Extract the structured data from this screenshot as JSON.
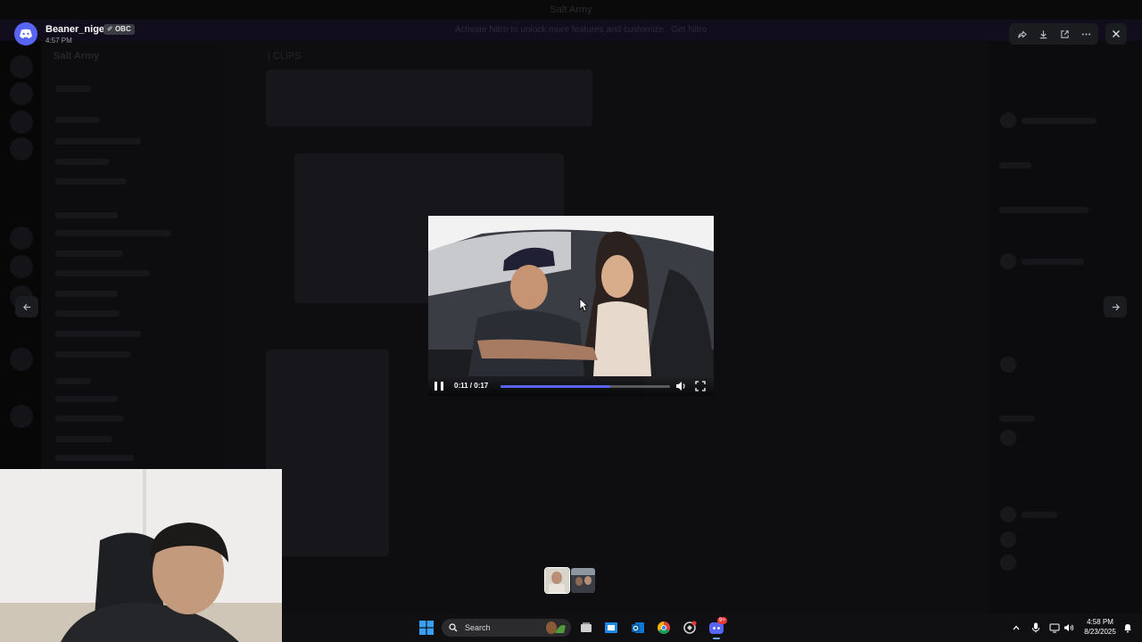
{
  "background": {
    "window_title": "Salt Army",
    "banner_text": "Activate Nitro to unlock more features and customize",
    "banner_button": "Get Nitro",
    "server_name": "Salt Army",
    "channel_header": "| CLIPS"
  },
  "viewer": {
    "uploader_name": "Beaner_niger",
    "uploader_badge": "OBC",
    "uploader_time": "4:57 PM",
    "actions": [
      "forward-icon",
      "download-icon",
      "open-in-browser-icon",
      "more-options-icon",
      "close-icon"
    ]
  },
  "video": {
    "current_time": "0:11",
    "duration": "0:17",
    "time_display": "0:11 / 0:17",
    "progress": 0.647,
    "playing": true
  },
  "taskbar": {
    "search_placeholder": "Search",
    "time": "4:58 PM",
    "date": "8/23/2025",
    "discord_badge": "9+"
  },
  "colors": {
    "accent": "#5865f2",
    "overlay": "#000000"
  }
}
